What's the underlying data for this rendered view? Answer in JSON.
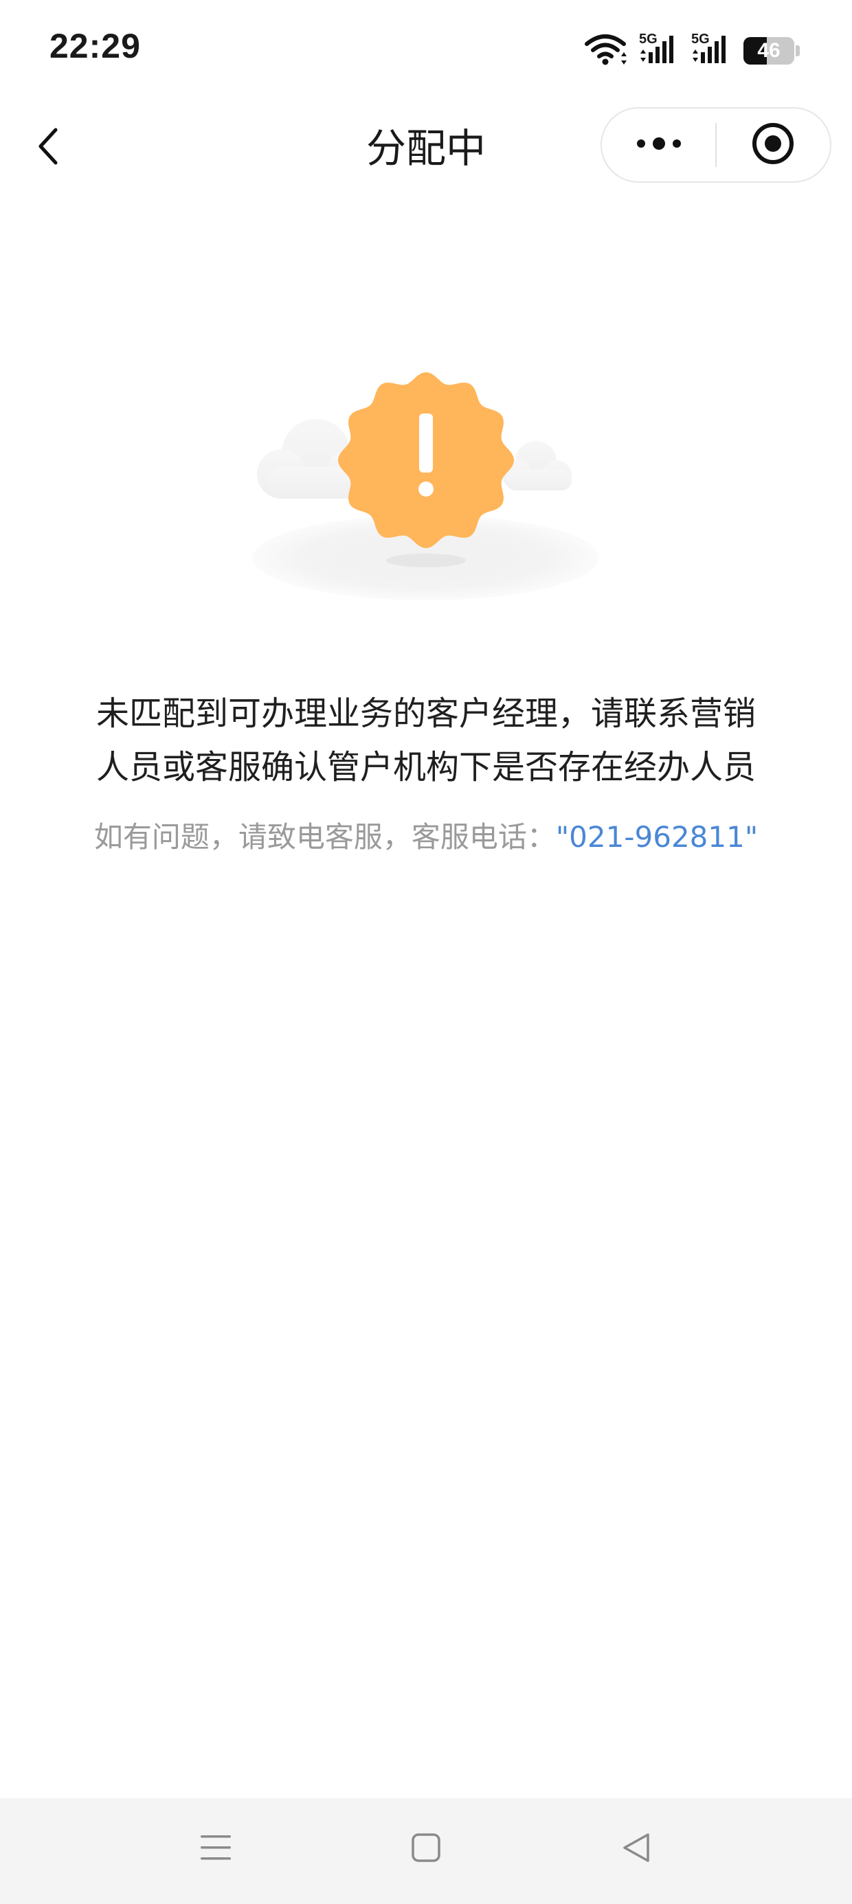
{
  "status_bar": {
    "time": "22:29",
    "network_1": "5G",
    "network_2": "5G",
    "battery_level": 46,
    "battery_text": "46"
  },
  "nav": {
    "title": "分配中",
    "back_icon": "chevron-left-icon",
    "more_icon": "more-dots-icon",
    "close_icon": "target-circle-icon"
  },
  "illustration": {
    "icon": "warning-badge-icon",
    "badge_color": "#FFB55A"
  },
  "message": {
    "line1": "未匹配到可办理业务的客户经理，请联系营销",
    "line2": "人员或客服确认管户机构下是否存在经办人员"
  },
  "hint": {
    "prefix": "如有问题，请致电客服，客服电话：",
    "phone": "\"021-962811\"",
    "phone_color": "#4A87D6"
  },
  "system_nav": {
    "menu_icon": "menu-icon",
    "home_icon": "home-square-icon",
    "back_icon": "back-triangle-icon"
  }
}
